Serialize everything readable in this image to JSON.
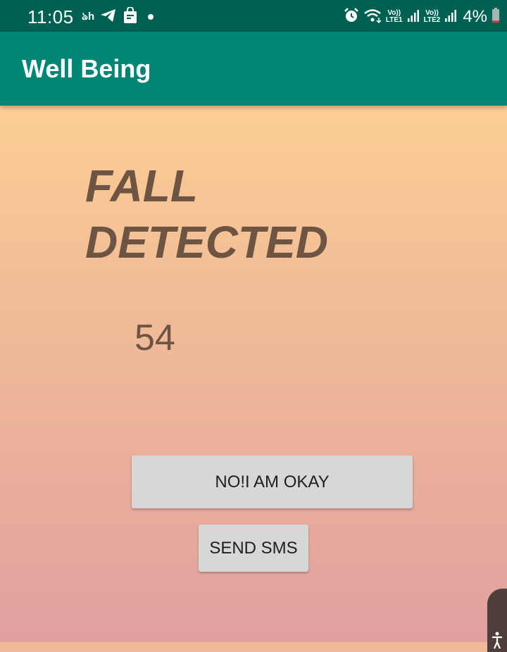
{
  "status_bar": {
    "time": "11:05",
    "notification_icons": [
      "bengali-keyboard-icon",
      "telegram-icon",
      "shopping-bag-icon"
    ],
    "keyboard_glyph": "ঌh",
    "sim1_label_top": "Vo))",
    "sim1_label_bottom": "LTE1",
    "sim2_label_top": "Vo))",
    "sim2_label_bottom": "LTE2",
    "battery": "4%"
  },
  "app_bar": {
    "title": "Well Being"
  },
  "alert": {
    "line1": "FALL",
    "line2": "DETECTED",
    "countdown": "54"
  },
  "actions": {
    "okay_label": "NO!I AM OKAY",
    "sms_label": "SEND SMS"
  },
  "colors": {
    "status_bar": "#006152",
    "app_bar": "#028575",
    "gradient_top": "#fccd94",
    "gradient_bottom": "#e1a0a0",
    "text_brown": "#6d5443",
    "button_bg": "#d7d7d7"
  }
}
